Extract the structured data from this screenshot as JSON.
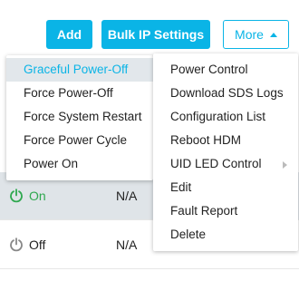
{
  "toolbar": {
    "add_label": "Add",
    "bulk_ip_label": "Bulk IP Settings",
    "more_label": "More"
  },
  "power_menu": {
    "items": [
      {
        "label": "Graceful Power-Off"
      },
      {
        "label": "Force Power-Off"
      },
      {
        "label": "Force System Restart"
      },
      {
        "label": "Force Power Cycle"
      },
      {
        "label": "Power On"
      }
    ],
    "highlighted_item": "Graceful Power-Off"
  },
  "more_menu": {
    "items": [
      {
        "label": "Power Control"
      },
      {
        "label": "Download SDS Logs"
      },
      {
        "label": "Configuration List"
      },
      {
        "label": "Reboot HDM"
      },
      {
        "label": "UID LED Control"
      },
      {
        "label": "Edit"
      },
      {
        "label": "Fault Report"
      },
      {
        "label": "Delete"
      }
    ]
  },
  "table": {
    "rows": [
      {
        "status": "On",
        "value": "N/A",
        "status_icon": "power-on-icon",
        "status_color": "#2fa84f"
      },
      {
        "status": "Off",
        "value": "N/A",
        "status_icon": "power-off-icon",
        "status_color": "#888888"
      }
    ]
  },
  "colors": {
    "accent": "#0ab4e6",
    "on_green": "#2fa84f",
    "off_gray": "#888888"
  }
}
